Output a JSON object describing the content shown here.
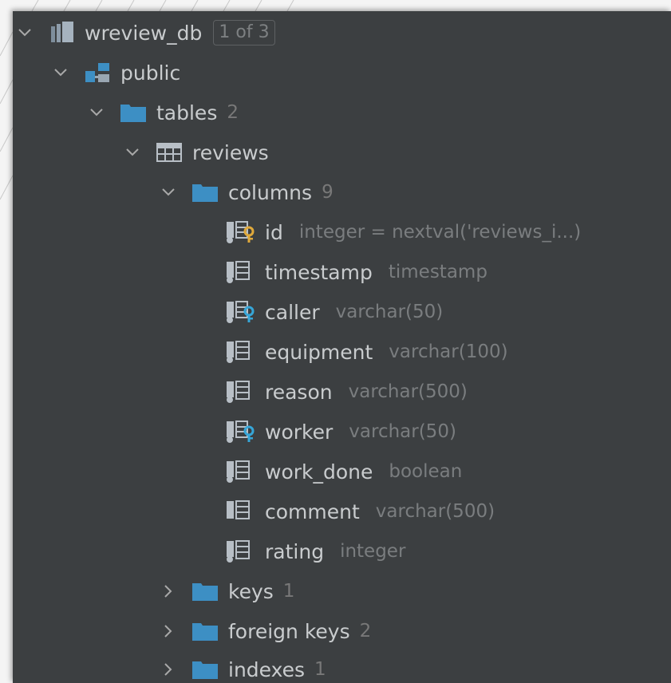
{
  "tree": {
    "database": {
      "label": "wreview_db",
      "badge": "1 of 3"
    },
    "schema": {
      "label": "public"
    },
    "tables_folder": {
      "label": "tables",
      "count": "2"
    },
    "table": {
      "label": "reviews"
    },
    "columns_folder": {
      "label": "columns",
      "count": "9"
    },
    "columns": [
      {
        "name": "id",
        "type": "integer = nextval('reviews_i...)",
        "icon": "column-primary-key-icon"
      },
      {
        "name": "timestamp",
        "type": "timestamp",
        "icon": "column-not-null-icon"
      },
      {
        "name": "caller",
        "type": "varchar(50)",
        "icon": "column-foreign-key-icon"
      },
      {
        "name": "equipment",
        "type": "varchar(100)",
        "icon": "column-not-null-icon"
      },
      {
        "name": "reason",
        "type": "varchar(500)",
        "icon": "column-not-null-icon"
      },
      {
        "name": "worker",
        "type": "varchar(50)",
        "icon": "column-foreign-key-icon"
      },
      {
        "name": "work_done",
        "type": "boolean",
        "icon": "column-not-null-icon"
      },
      {
        "name": "comment",
        "type": "varchar(500)",
        "icon": "column-icon"
      },
      {
        "name": "rating",
        "type": "integer",
        "icon": "column-not-null-icon"
      }
    ],
    "keys_folder": {
      "label": "keys",
      "count": "1"
    },
    "foreign_keys_folder": {
      "label": "foreign keys",
      "count": "2"
    },
    "indexes_folder": {
      "label": "indexes",
      "count": "1"
    }
  },
  "colors": {
    "background": "#3c3f41",
    "text": "#c9ccce",
    "muted": "#787878",
    "folder": "#3d8fc4",
    "primary_key": "#e0a93b",
    "foreign_key": "#36a6d8"
  }
}
